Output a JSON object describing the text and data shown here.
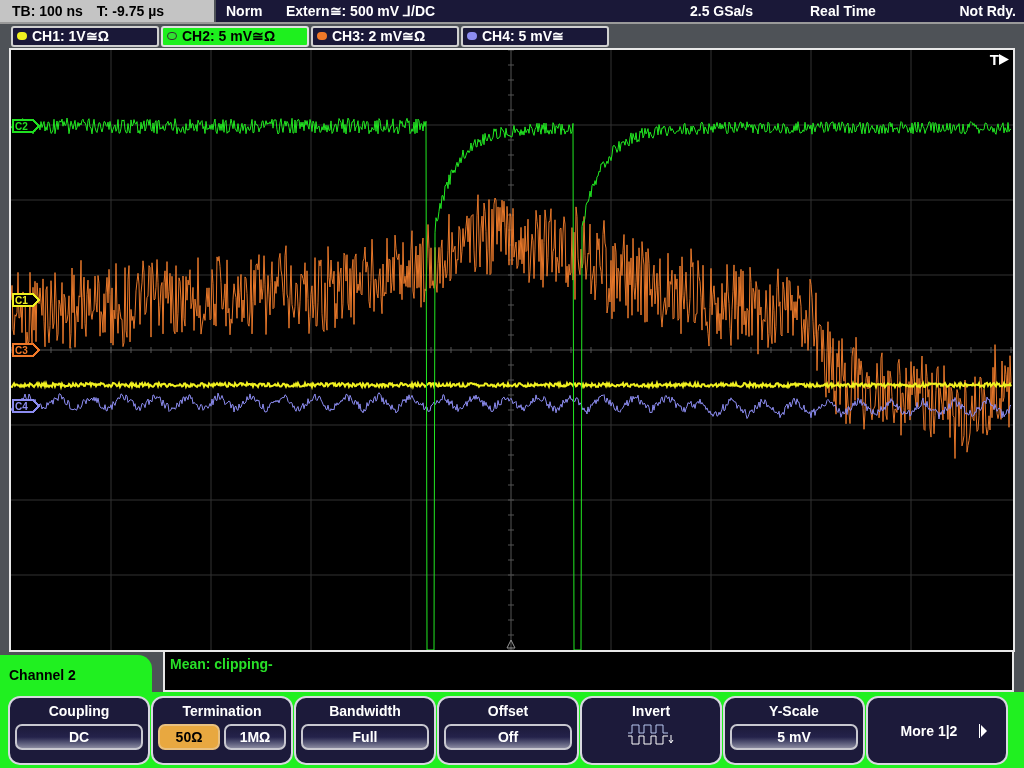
{
  "status_bar": {
    "timebase": "TB: 100 ns",
    "trigger_time": "T: -9.75 µs",
    "mode": "Norm",
    "trigger_source": "Extern≅: 500 mV ⅃/DC",
    "sample_rate": "2.5 GSa/s",
    "acquisition": "Real Time",
    "state": "Not Rdy."
  },
  "channel_tabs": [
    {
      "label": "CH1: 1V≅Ω",
      "color": "#f0f020",
      "selected": false
    },
    {
      "label": "CH2: 5 mV≅Ω",
      "color": "#30e030",
      "selected": true
    },
    {
      "label": "CH3: 2 mV≅Ω",
      "color": "#f07828",
      "selected": false
    },
    {
      "label": "CH4: 5 mV≅",
      "color": "#8c8cf0",
      "selected": false
    }
  ],
  "plot": {
    "trigger_label": "T",
    "markers": [
      {
        "label": "C2",
        "color": "#20e020"
      },
      {
        "label": "C1",
        "color": "#f0f020"
      },
      {
        "label": "C3",
        "color": "#f07828"
      },
      {
        "label": "C4",
        "color": "#8c8cf0"
      }
    ]
  },
  "measurement": {
    "text": "Mean: clipping-"
  },
  "menu": {
    "title": "Channel 2",
    "softkeys": [
      {
        "kind": "value",
        "label": "Coupling",
        "value": "DC"
      },
      {
        "kind": "toggle",
        "label": "Termination",
        "options": [
          {
            "label": "50Ω",
            "selected": true
          },
          {
            "label": "1MΩ",
            "selected": false
          }
        ]
      },
      {
        "kind": "value",
        "label": "Bandwidth",
        "value": "Full"
      },
      {
        "kind": "value",
        "label": "Offset",
        "value": "Off"
      },
      {
        "kind": "icon",
        "label": "Invert"
      },
      {
        "kind": "value",
        "label": "Y-Scale",
        "value": "5 mV"
      },
      {
        "kind": "more",
        "label": "More 1|2"
      }
    ]
  }
}
